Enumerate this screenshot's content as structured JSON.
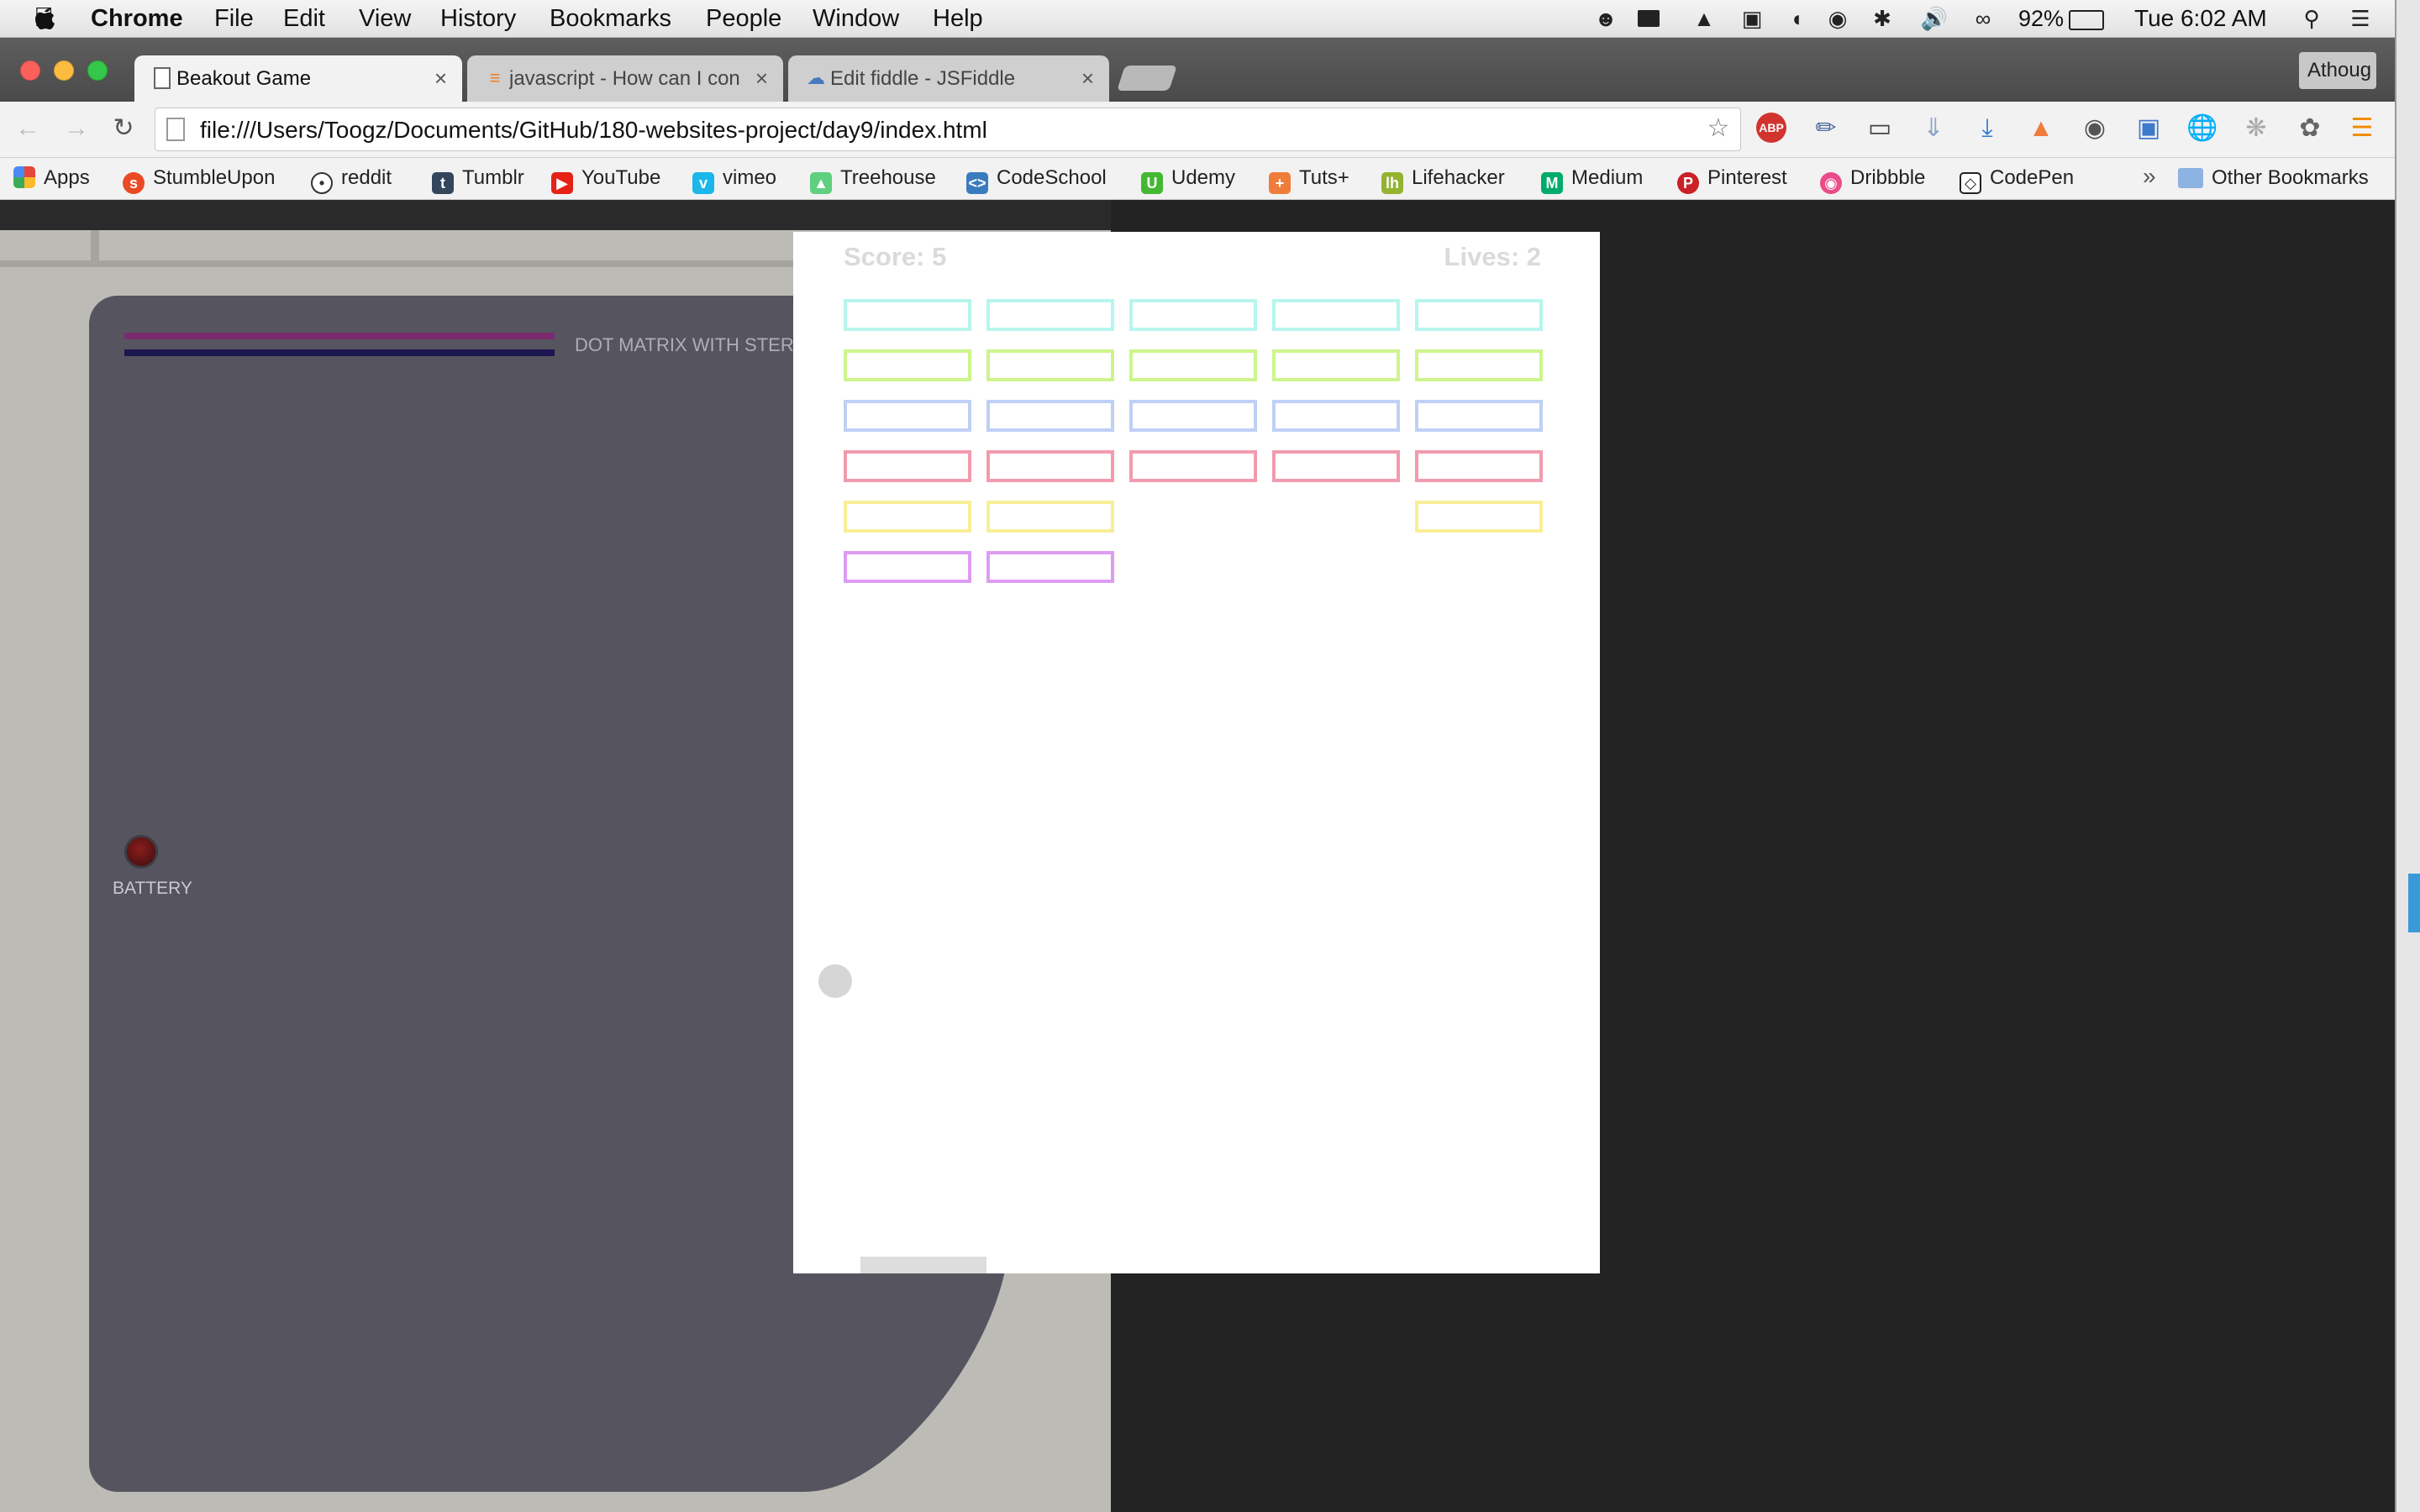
{
  "menubar": {
    "app_name": "Chrome",
    "menus": [
      "File",
      "Edit",
      "View",
      "History",
      "Bookmarks",
      "People",
      "Window",
      "Help"
    ],
    "battery": "92%",
    "clock": "Tue 6:02 AM"
  },
  "profile_button": "Athoug",
  "tabs": [
    {
      "title": "Beakout Game",
      "icon": "page-icon",
      "active": true
    },
    {
      "title": "javascript - How can I con",
      "icon": "stackoverflow-icon",
      "active": false
    },
    {
      "title": "Edit fiddle - JSFiddle",
      "icon": "jsfiddle-icon",
      "active": false
    }
  ],
  "address": "file:///Users/Toogz/Documents/GitHub/180-websites-project/day9/index.html",
  "bookmarks": [
    {
      "label": "Apps",
      "icon": "apps-grid-icon",
      "color": "#e8453c"
    },
    {
      "label": "StumbleUpon",
      "icon": "stumbleupon-icon",
      "color": "#eb4924"
    },
    {
      "label": "reddit",
      "icon": "reddit-icon",
      "color": "#5f99cf"
    },
    {
      "label": "Tumblr",
      "icon": "tumblr-icon",
      "color": "#35465c"
    },
    {
      "label": "YouTube",
      "icon": "youtube-icon",
      "color": "#e62117"
    },
    {
      "label": "vimeo",
      "icon": "vimeo-icon",
      "color": "#1ab7ea"
    },
    {
      "label": "Treehouse",
      "icon": "treehouse-icon",
      "color": "#5fcf80"
    },
    {
      "label": "CodeSchool",
      "icon": "codeschool-icon",
      "color": "#3a7bbf"
    },
    {
      "label": "Udemy",
      "icon": "udemy-icon",
      "color": "#44b833"
    },
    {
      "label": "Tuts+",
      "icon": "tutsplus-icon",
      "color": "#f07c3c"
    },
    {
      "label": "Lifehacker",
      "icon": "lifehacker-icon",
      "color": "#94b330"
    },
    {
      "label": "Medium",
      "icon": "medium-icon",
      "color": "#00ab6c"
    },
    {
      "label": "Pinterest",
      "icon": "pinterest-icon",
      "color": "#cb2027"
    },
    {
      "label": "Dribbble",
      "icon": "dribbble-icon",
      "color": "#ea4c89"
    },
    {
      "label": "CodePen",
      "icon": "codepen-icon",
      "color": "#222222"
    }
  ],
  "bookmarks_overflow": "»",
  "other_bookmarks": "Other Bookmarks",
  "gameboy": {
    "label": "DOT MATRIX WITH STEREO",
    "battery_label": "BATTERY",
    "stripe_colors": [
      "#7b2a6e",
      "#1c1650"
    ]
  },
  "game": {
    "score": "Score: 5",
    "lives": "Lives: 2",
    "brick_colors": [
      "#b6f6ec",
      "#cdf58c",
      "#bfd0f6",
      "#f29aae",
      "#f8ee97",
      "#dd9cf4"
    ],
    "brick_grid": [
      [
        1,
        1,
        1,
        1,
        1
      ],
      [
        1,
        1,
        1,
        1,
        1
      ],
      [
        1,
        1,
        1,
        1,
        1
      ],
      [
        1,
        1,
        1,
        1,
        1
      ],
      [
        1,
        1,
        0,
        0,
        1
      ],
      [
        1,
        1,
        0,
        0,
        0
      ]
    ]
  }
}
